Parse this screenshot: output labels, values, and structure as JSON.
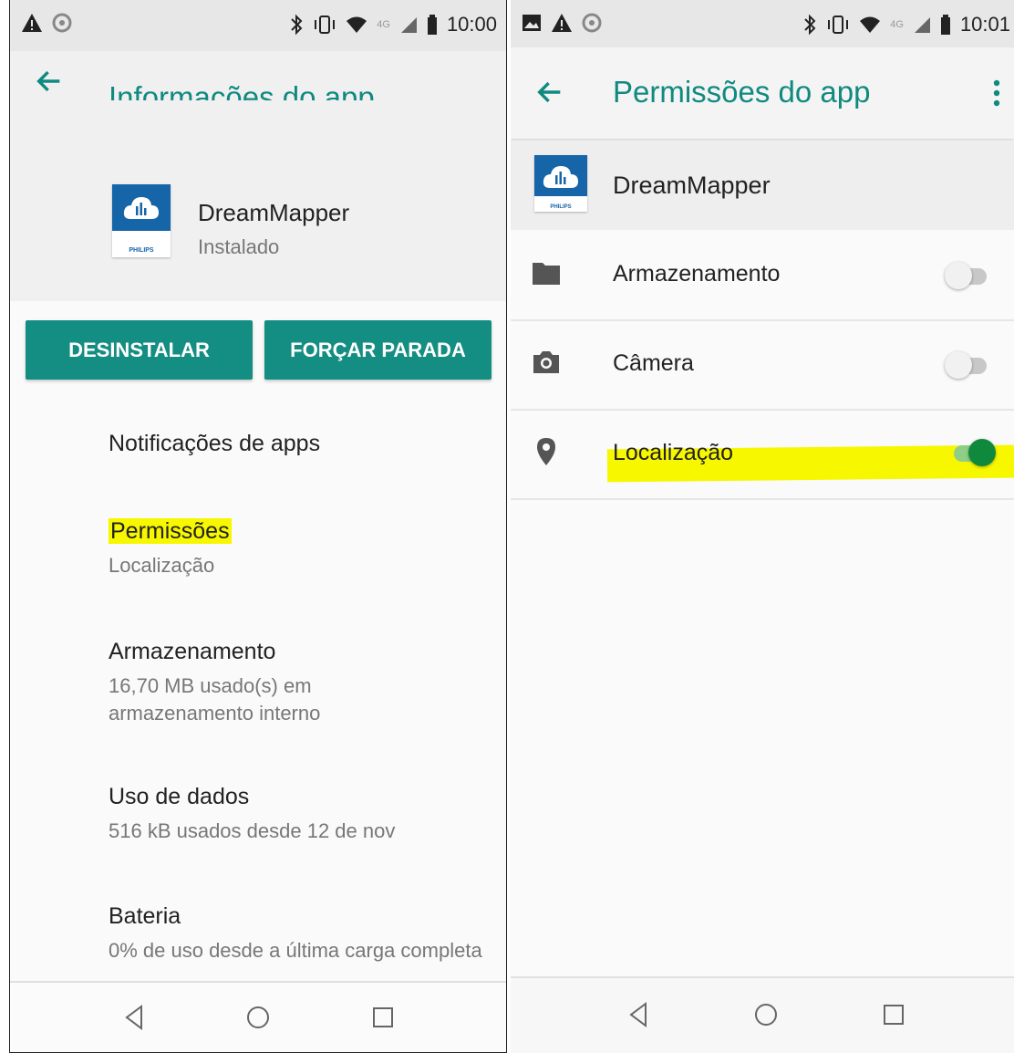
{
  "left": {
    "status_time": "10:00",
    "status_net": "4G",
    "title": "Informações do app",
    "app": {
      "name": "DreamMapper",
      "status": "Instalado",
      "brand": "PHILIPS"
    },
    "buttons": {
      "uninstall": "DESINSTALAR",
      "force_stop": "FORÇAR PARADA"
    },
    "items": [
      {
        "title": "Notificações de apps",
        "subtitle": ""
      },
      {
        "title": "Permissões",
        "subtitle": "Localização"
      },
      {
        "title": "Armazenamento",
        "subtitle": "16,70 MB usado(s) em armazenamento interno"
      },
      {
        "title": "Uso de dados",
        "subtitle": "516 kB usados desde 12 de nov"
      },
      {
        "title": "Bateria",
        "subtitle": "0% de uso desde a última carga completa"
      }
    ]
  },
  "right": {
    "status_time": "10:01",
    "status_net": "4G",
    "title": "Permissões do app",
    "app": {
      "name": "DreamMapper",
      "brand": "PHILIPS"
    },
    "permissions": [
      {
        "label": "Armazenamento",
        "icon": "folder-icon",
        "enabled": false
      },
      {
        "label": "Câmera",
        "icon": "camera-icon",
        "enabled": false
      },
      {
        "label": "Localização",
        "icon": "location-pin-icon",
        "enabled": true
      }
    ]
  },
  "colors": {
    "accent": "#108a80",
    "button": "#148e82",
    "highlight": "#f7f700",
    "switch_on": "#0f8a3c"
  }
}
